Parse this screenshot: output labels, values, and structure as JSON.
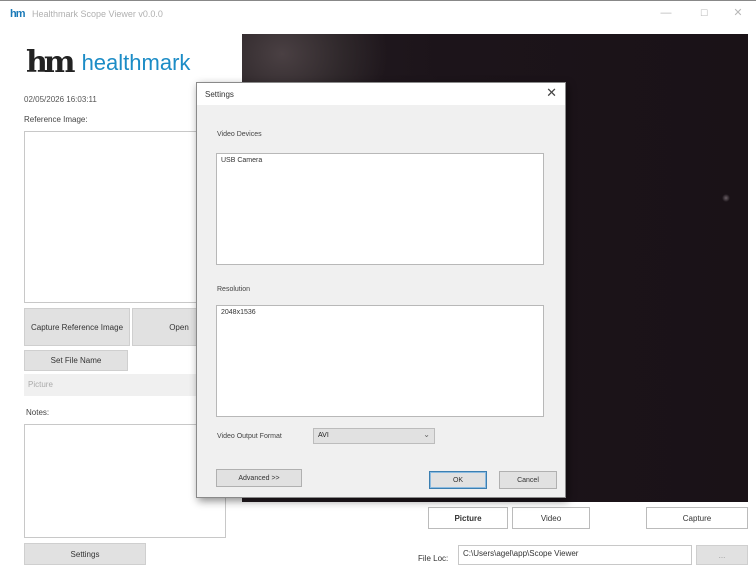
{
  "window": {
    "app_icon": "hm",
    "title": "Healthmark Scope Viewer v0.0.0",
    "min_label": "—",
    "max_label": "☐",
    "close_label": "✕"
  },
  "logo": {
    "mark": "hm",
    "text": "healthmark"
  },
  "timestamp": "02/05/2026 16:03:11",
  "reference": {
    "label": "Reference Image:",
    "capture_button": "Capture Reference Image",
    "open_button": "Open",
    "set_file_name_button": "Set File Name",
    "picture_label": "Picture"
  },
  "notes": {
    "label": "Notes:"
  },
  "settings_button": "Settings",
  "video_controls": {
    "picture_button": "Picture",
    "video_button": "Video",
    "capture_button": "Capture"
  },
  "file_location": {
    "label": "File Loc:",
    "value": "C:\\Users\\agel\\app\\Scope Viewer",
    "browse_button": "..."
  },
  "dialog": {
    "title": "Settings",
    "close_label": "✕",
    "video_devices_label": "Video Devices",
    "video_devices": [
      "USB Camera"
    ],
    "resolution_label": "Resolution",
    "resolutions": [
      "2048x1536"
    ],
    "output_format_label": "Video Output Format",
    "output_format_value": "AVI",
    "advanced_button": "Advanced >>",
    "ok_button": "OK",
    "cancel_button": "Cancel"
  }
}
